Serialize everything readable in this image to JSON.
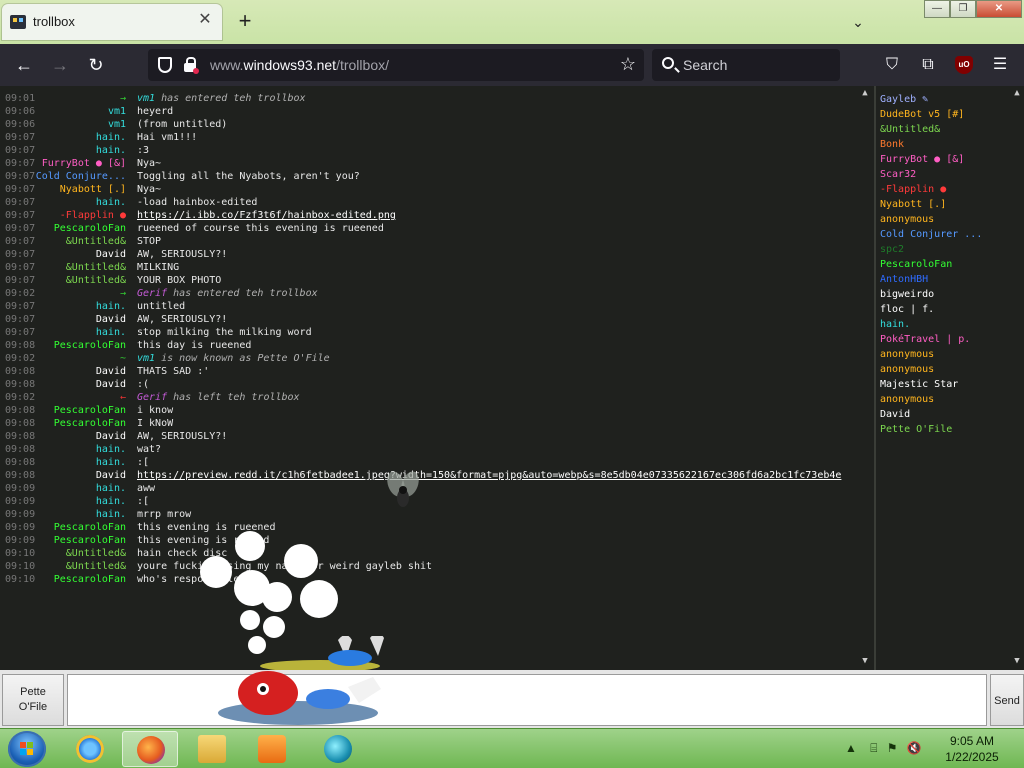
{
  "browser": {
    "tab_title": "trollbox",
    "tab_close": "✕",
    "new_tab": "+",
    "tab_list": "⌄",
    "url_host_prefix": "www.",
    "url_host": "windows93.net",
    "url_path": "/trollbox/",
    "search_placeholder": "Search",
    "window_controls": {
      "minimize": "—",
      "maximize": "❐",
      "close": "✕"
    }
  },
  "messages": [
    {
      "time": "09:01",
      "nick": "→",
      "nick_color": "#3c3",
      "text": "vm1 has entered teh trollbox",
      "sys": true,
      "text_nick": "vm1",
      "text_nick_color": "#3dd"
    },
    {
      "time": "09:06",
      "nick": "vm1",
      "nick_color": "#3dd",
      "text": "heyerd"
    },
    {
      "time": "09:06",
      "nick": "vm1",
      "nick_color": "#3dd",
      "text": "(from untitled)"
    },
    {
      "time": "09:07",
      "nick": "hain.",
      "nick_color": "#3dd",
      "text": "Hai vm1!!!"
    },
    {
      "time": "09:07",
      "nick": "hain.",
      "nick_color": "#3dd",
      "text": ":3"
    },
    {
      "time": "09:07",
      "nick": "FurryBot ● [&]",
      "nick_color": "#ff5ec4",
      "text": "Nya~"
    },
    {
      "time": "09:07",
      "nick": "Cold Conjure...",
      "nick_color": "#5599ff",
      "text": "Toggling all the Nyabots, aren't you?"
    },
    {
      "time": "09:07",
      "nick": "Nyabott [.]",
      "nick_color": "#ffb51e",
      "text": "Nya~"
    },
    {
      "time": "09:07",
      "nick": "hain.",
      "nick_color": "#3dd",
      "text": "-load hainbox-edited"
    },
    {
      "time": "09:07",
      "nick": "-Flapplin ●",
      "nick_color": "#ff3a3a",
      "text": "https://i.ibb.co/Fzf3t6f/hainbox-edited.png",
      "link": true
    },
    {
      "time": "09:07",
      "nick": "PescaroloFan",
      "nick_color": "#3f3",
      "text": "rueened of course this evening is rueened"
    },
    {
      "time": "09:07",
      "nick": "&Untitled&",
      "nick_color": "#7cd64f",
      "text": "STOP"
    },
    {
      "time": "09:07",
      "nick": "David",
      "nick_color": "#ffffff",
      "text": "AW, SERIOUSLY?!"
    },
    {
      "time": "09:07",
      "nick": "&Untitled&",
      "nick_color": "#7cd64f",
      "text": "MILKING"
    },
    {
      "time": "09:07",
      "nick": "&Untitled&",
      "nick_color": "#7cd64f",
      "text": "YOUR BOX PHOTO"
    },
    {
      "time": "09:02",
      "nick": "→",
      "nick_color": "#3c3",
      "text": "Gerif has entered teh trollbox",
      "sys": true,
      "text_nick": "Gerif",
      "text_nick_color": "#c45bd6"
    },
    {
      "time": "09:07",
      "nick": "hain.",
      "nick_color": "#3dd",
      "text": "untitled"
    },
    {
      "time": "09:07",
      "nick": "David",
      "nick_color": "#ffffff",
      "text": "AW, SERIOUSLY?!"
    },
    {
      "time": "09:07",
      "nick": "hain.",
      "nick_color": "#3dd",
      "text": "stop milking the milking word"
    },
    {
      "time": "09:08",
      "nick": "PescaroloFan",
      "nick_color": "#3f3",
      "text": "this day is rueened"
    },
    {
      "time": "09:02",
      "nick": "~",
      "nick_color": "#3c3",
      "text": "vm1 is now known as Pette O'File",
      "sys": true,
      "text_nick": "vm1",
      "text_nick_color": "#3dd"
    },
    {
      "time": "09:08",
      "nick": "David",
      "nick_color": "#ffffff",
      "text": "THATS SAD :'"
    },
    {
      "time": "09:08",
      "nick": "David",
      "nick_color": "#ffffff",
      "text": ":("
    },
    {
      "time": "09:02",
      "nick": "←",
      "nick_color": "#e33",
      "text": "Gerif has left teh trollbox",
      "sys": true,
      "text_nick": "Gerif",
      "text_nick_color": "#c45bd6"
    },
    {
      "time": "09:08",
      "nick": "PescaroloFan",
      "nick_color": "#3f3",
      "text": "i know"
    },
    {
      "time": "09:08",
      "nick": "PescaroloFan",
      "nick_color": "#3f3",
      "text": "I kNoW"
    },
    {
      "time": "09:08",
      "nick": "David",
      "nick_color": "#ffffff",
      "text": "AW, SERIOUSLY?!"
    },
    {
      "time": "09:08",
      "nick": "hain.",
      "nick_color": "#3dd",
      "text": "wat?"
    },
    {
      "time": "09:08",
      "nick": "hain.",
      "nick_color": "#3dd",
      "text": ":["
    },
    {
      "time": "09:08",
      "nick": "David",
      "nick_color": "#ffffff",
      "text": "https://preview.redd.it/c1h6fetbadee1.jpeg?width=150&format=pjpg&auto=webp&s=8e5db04e07335622167ec306fd6a2bc1fc73eb4e",
      "link": true
    },
    {
      "time": "09:09",
      "nick": "hain.",
      "nick_color": "#3dd",
      "text": "aww"
    },
    {
      "time": "09:09",
      "nick": "hain.",
      "nick_color": "#3dd",
      "text": ":["
    },
    {
      "time": "09:09",
      "nick": "hain.",
      "nick_color": "#3dd",
      "text": "mrrp mrow"
    },
    {
      "time": "09:09",
      "nick": "PescaroloFan",
      "nick_color": "#3f3",
      "text": "this evening is rueened"
    },
    {
      "time": "09:09",
      "nick": "PescaroloFan",
      "nick_color": "#3f3",
      "text": "this evening is ruined"
    },
    {
      "time": "09:10",
      "nick": "&Untitled&",
      "nick_color": "#7cd64f",
      "text": "hain check disc"
    },
    {
      "time": "09:10",
      "nick": "&Untitled&",
      "nick_color": "#7cd64f",
      "text": "youre fucking using my name for weird gayleb shit"
    },
    {
      "time": "09:10",
      "nick": "PescaroloFan",
      "nick_color": "#3f3",
      "text": "who's responsible"
    }
  ],
  "users": [
    {
      "name": "Gayleb ✎",
      "color": "#9fb0ff"
    },
    {
      "name": "DudeBot v5 [#]",
      "color": "#ffb51e"
    },
    {
      "name": "&Untitled&",
      "color": "#7cd64f"
    },
    {
      "name": "Bonk",
      "color": "#ff7a2e"
    },
    {
      "name": "FurryBot ● [&]",
      "color": "#ff5ec4"
    },
    {
      "name": "Scar32",
      "color": "#ff5ec4"
    },
    {
      "name": "-Flapplin ●",
      "color": "#ff3a3a"
    },
    {
      "name": "Nyabott [.]",
      "color": "#ffb51e"
    },
    {
      "name": "anonymous",
      "color": "#ffb51e"
    },
    {
      "name": "Cold Conjurer ...",
      "color": "#5599ff"
    },
    {
      "name": "spc2",
      "color": "#1f7a2a"
    },
    {
      "name": "PescaroloFan",
      "color": "#3f3"
    },
    {
      "name": "AntonHBH",
      "color": "#2f6bff"
    },
    {
      "name": "bigweirdo",
      "color": "#ffffff"
    },
    {
      "name": "floc | f.",
      "color": "#ffffff"
    },
    {
      "name": "hain.",
      "color": "#3dd"
    },
    {
      "name": "PokéTravel | p.",
      "color": "#ff5ec4"
    },
    {
      "name": "anonymous",
      "color": "#ffb51e"
    },
    {
      "name": "anonymous",
      "color": "#ffb51e"
    },
    {
      "name": "Majestic Star",
      "color": "#ffffff"
    },
    {
      "name": "anonymous",
      "color": "#ffb51e"
    },
    {
      "name": "David",
      "color": "#ffffff"
    },
    {
      "name": "Pette O'File",
      "color": "#7cd64f"
    }
  ],
  "input": {
    "nick_button_line1": "Pette",
    "nick_button_line2": "O'File",
    "send_label": "Send"
  },
  "taskbar": {
    "time": "9:05 AM",
    "date": "1/22/2025"
  }
}
